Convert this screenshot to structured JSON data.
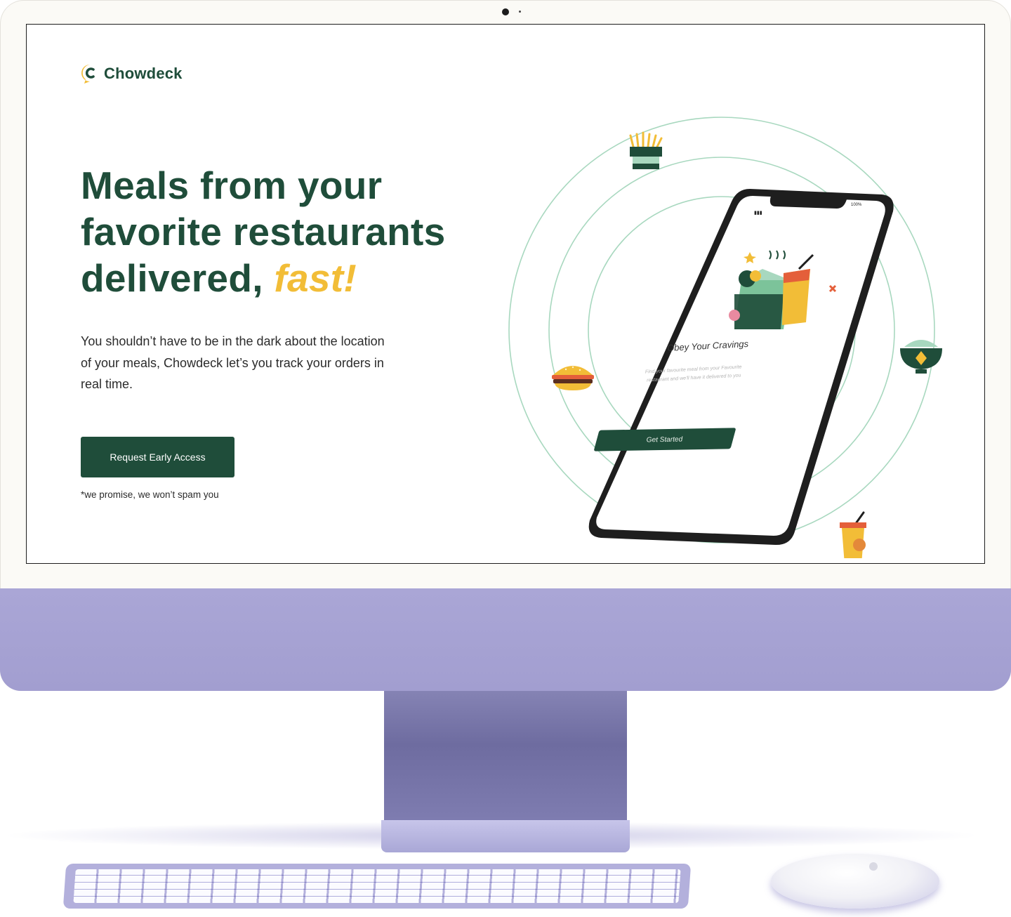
{
  "brand": {
    "name": "Chowdeck",
    "icon": "chowdeck-logo-icon"
  },
  "hero": {
    "headline_line1": "Meals from your",
    "headline_line2": "favorite restaurants",
    "headline_line3": "delivered,",
    "headline_accent": "fast!",
    "subtext": "You shouldn’t have to be in the dark about the location of your meals, Chowdeck let’s you track your orders in real time.",
    "cta_label": "Request Early Access",
    "note": "*we promise, we won’t spam you"
  },
  "phone": {
    "battery": "100%",
    "title": "Obey Your Cravings",
    "description": "Find your favourite meal from your Favourite restaurant and we'll have it delivered to you",
    "button_label": "Get Started"
  },
  "colors": {
    "brand_green": "#1f4d3a",
    "accent_yellow": "#f2bd37",
    "orbit_green": "#a8d8bf",
    "imac_purple": "#a6a2d3"
  },
  "decor_icons": [
    "fries-icon",
    "burger-icon",
    "rice-bowl-icon",
    "drink-cup-icon",
    "food-box-icon"
  ]
}
